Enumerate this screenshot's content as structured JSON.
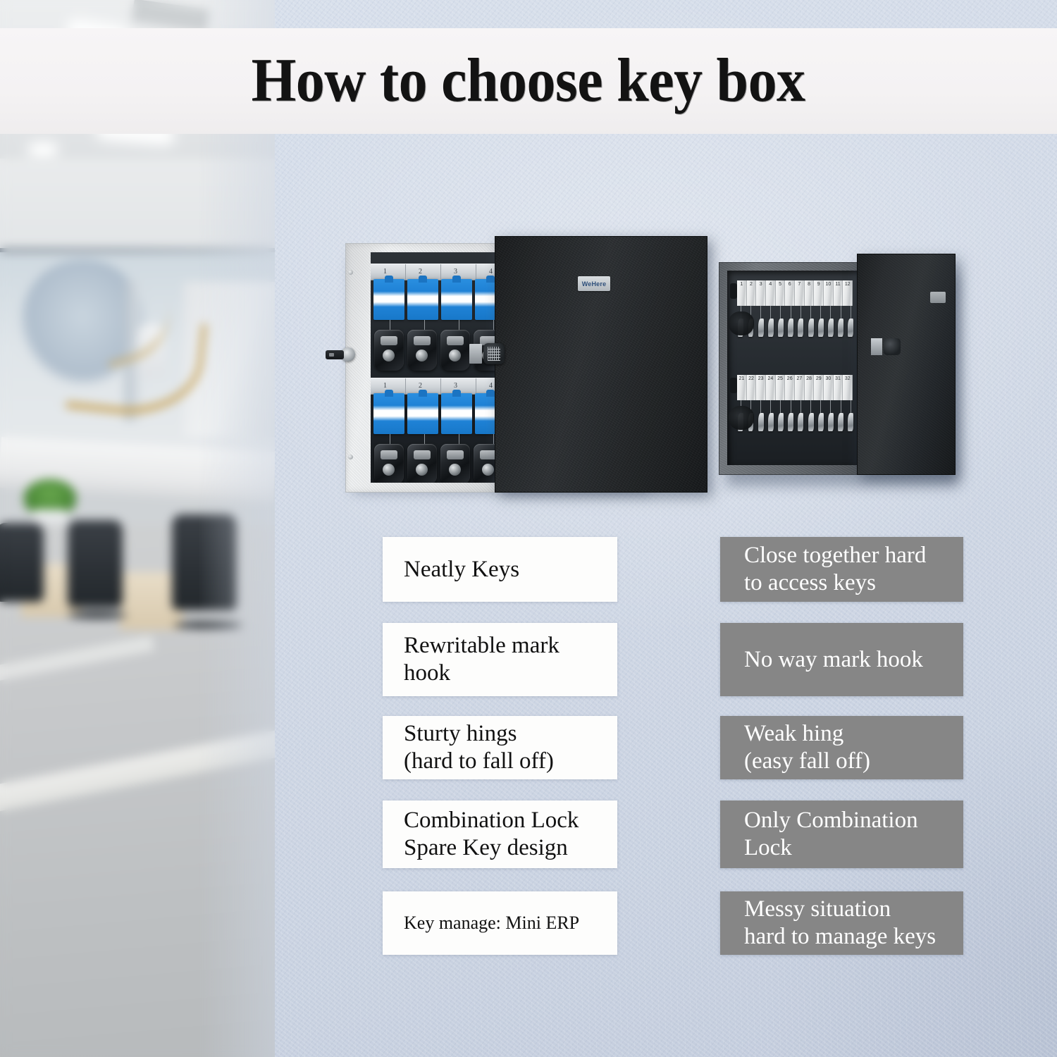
{
  "banner": {
    "title": "How to choose key box"
  },
  "colors": {
    "wall": "#d2dae7",
    "banner_bg": "#f5f3f4",
    "pro_box_bg": "#fdfdfc",
    "pro_text": "#111111",
    "con_box_bg": "#868686",
    "con_text": "#ffffff",
    "tag_blue": "#1f82d6",
    "door_black": "#22262a"
  },
  "products": {
    "good": {
      "brand_label": "WeHere",
      "lock_type": "combination-dial",
      "spare_key": "inserted",
      "hook_row_numbers": [
        "1",
        "2",
        "3",
        "4"
      ],
      "tag_color": "blue",
      "rows": 2
    },
    "bad": {
      "tag_numbers_row1": [
        "1",
        "2",
        "3",
        "4",
        "5",
        "6",
        "7",
        "8",
        "9",
        "10",
        "11",
        "12"
      ],
      "tag_numbers_row2": [
        "21",
        "22",
        "23",
        "24",
        "25",
        "26",
        "27",
        "28",
        "29",
        "30",
        "31",
        "32"
      ],
      "lock_type": "combination-dial",
      "tag_color": "white",
      "rows": 2
    }
  },
  "comparison": {
    "pros": [
      {
        "text": "Neatly Keys",
        "small": false
      },
      {
        "text": "Rewritable mark\nhook",
        "small": false
      },
      {
        "text": "Sturty hings\n(hard to fall off)",
        "small": false
      },
      {
        "text": "Combination Lock\nSpare Key design",
        "small": false
      },
      {
        "text": "Key manage: Mini ERP",
        "small": true
      }
    ],
    "cons": [
      {
        "text": "Close together hard\nto access keys",
        "small": false
      },
      {
        "text": "No way mark hook",
        "small": false
      },
      {
        "text": "Weak hing\n(easy fall off)",
        "small": false
      },
      {
        "text": "Only Combination\nLock",
        "small": false
      },
      {
        "text": "Messy situation\nhard to manage keys",
        "small": false
      }
    ]
  },
  "scene": {
    "background_left": "blurred-office-interior",
    "wall_texture": "stucco"
  }
}
